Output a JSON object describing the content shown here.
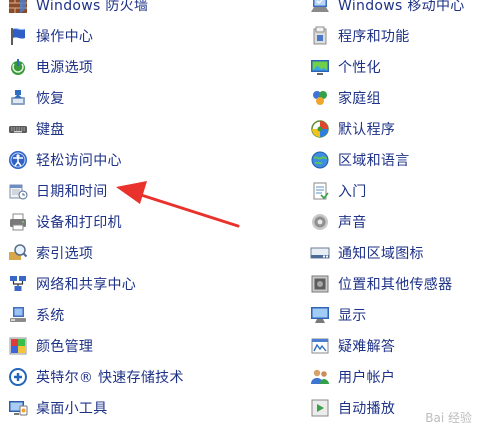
{
  "left_items": [
    {
      "label": "Windows 防火墙",
      "icon": "firewall-icon"
    },
    {
      "label": "操作中心",
      "icon": "flag-icon"
    },
    {
      "label": "电源选项",
      "icon": "power-icon"
    },
    {
      "label": "恢复",
      "icon": "recovery-icon"
    },
    {
      "label": "键盘",
      "icon": "keyboard-icon"
    },
    {
      "label": "轻松访问中心",
      "icon": "ease-of-access-icon"
    },
    {
      "label": "日期和时间",
      "icon": "calendar-clock-icon"
    },
    {
      "label": "设备和打印机",
      "icon": "printer-icon"
    },
    {
      "label": "索引选项",
      "icon": "search-index-icon"
    },
    {
      "label": "网络和共享中心",
      "icon": "network-icon"
    },
    {
      "label": "系统",
      "icon": "system-icon"
    },
    {
      "label": "颜色管理",
      "icon": "color-management-icon"
    },
    {
      "label": "英特尔® 快速存储技术",
      "icon": "storage-icon"
    },
    {
      "label": "桌面小工具",
      "icon": "gadgets-icon"
    }
  ],
  "right_items": [
    {
      "label": "Windows 移动中心",
      "icon": "mobility-center-icon"
    },
    {
      "label": "程序和功能",
      "icon": "programs-icon"
    },
    {
      "label": "个性化",
      "icon": "personalization-icon"
    },
    {
      "label": "家庭组",
      "icon": "homegroup-icon"
    },
    {
      "label": "默认程序",
      "icon": "default-programs-icon"
    },
    {
      "label": "区域和语言",
      "icon": "globe-icon"
    },
    {
      "label": "入门",
      "icon": "getting-started-icon"
    },
    {
      "label": "声音",
      "icon": "speaker-icon"
    },
    {
      "label": "通知区域图标",
      "icon": "notification-icon"
    },
    {
      "label": "位置和其他传感器",
      "icon": "sensor-icon"
    },
    {
      "label": "显示",
      "icon": "display-icon"
    },
    {
      "label": "疑难解答",
      "icon": "troubleshooting-icon"
    },
    {
      "label": "用户帐户",
      "icon": "user-accounts-icon"
    },
    {
      "label": "自动播放",
      "icon": "autoplay-icon"
    }
  ],
  "annotation": {
    "color": "#e8322b",
    "points_to": "日期和时间"
  },
  "watermark": {
    "text": "Bai 经验"
  },
  "colors": {
    "link": "#1e3287",
    "background": "#ffffff"
  }
}
